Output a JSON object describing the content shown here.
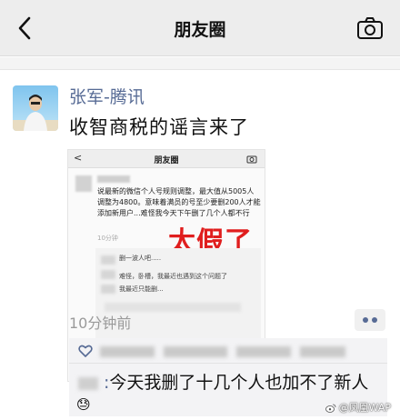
{
  "nav": {
    "title": "朋友圈"
  },
  "post": {
    "author": "张军-腾讯",
    "content": "收智商税的谣言来了",
    "time": "10分钟前",
    "screenshot": {
      "nav_back": "<",
      "nav_title": "朋友圈",
      "text": "说最新的微信个人号规则调整，最大值从5005人调整为4800。意味着满员的号至少要删200人才能添加新用户...难怪我今天下午删了几个人都不行",
      "time": "10分钟",
      "overlay": "太假了",
      "comment_1": "删一波人吧.....",
      "comment_2": "难怪，卧槽，我最近也遇到这个问题了",
      "comment_3": "我最近只能删..."
    },
    "comment": {
      "colon": ":",
      "text": "今天我删了十几个人也加不了新人"
    }
  },
  "watermark": {
    "text": "@凤凰WAP"
  }
}
